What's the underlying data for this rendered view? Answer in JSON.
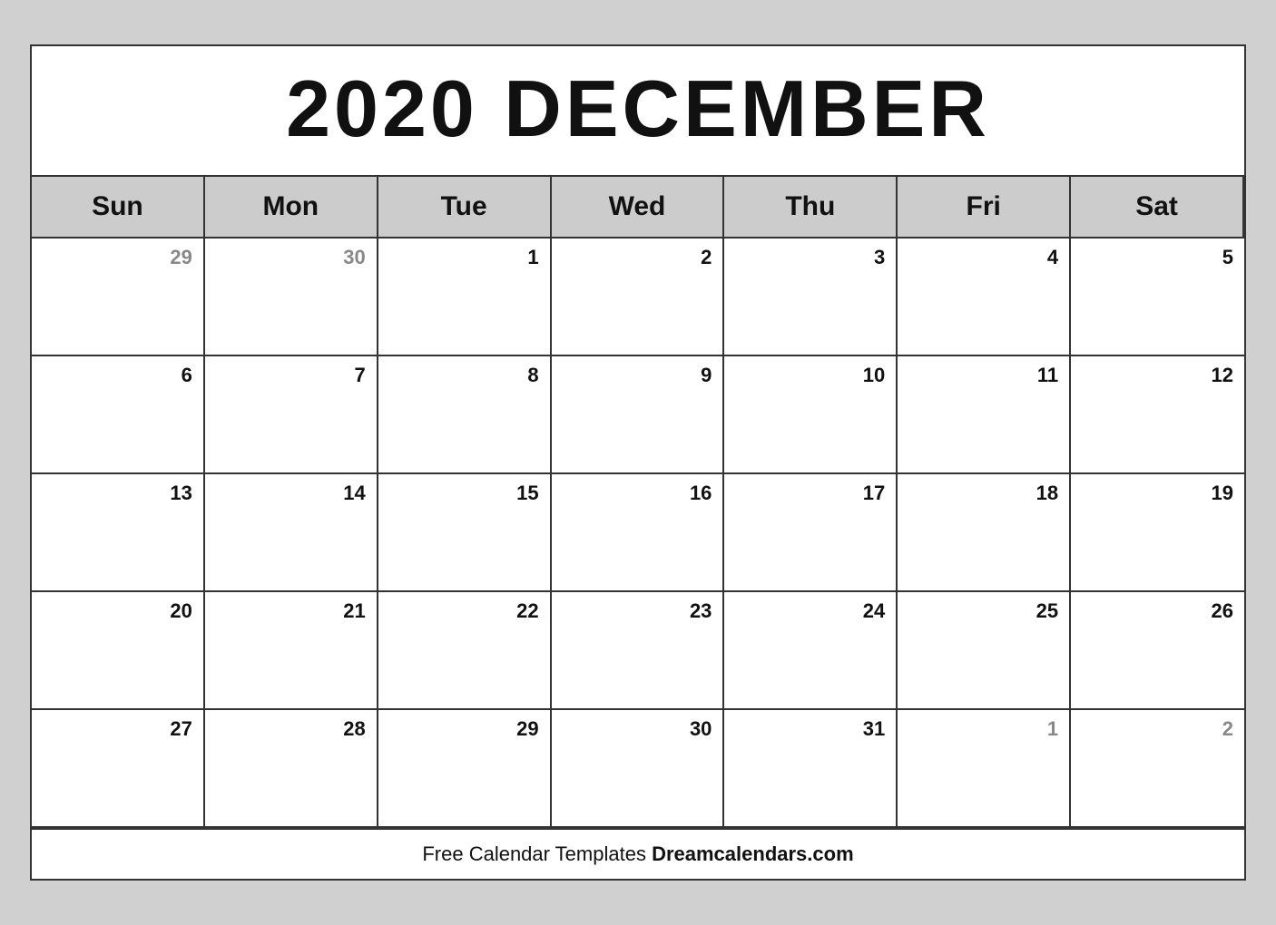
{
  "header": {
    "title": "2020 DECEMBER"
  },
  "day_headers": [
    "Sun",
    "Mon",
    "Tue",
    "Wed",
    "Thu",
    "Fri",
    "Sat"
  ],
  "weeks": [
    [
      {
        "label": "29",
        "outside": true
      },
      {
        "label": "30",
        "outside": true
      },
      {
        "label": "1",
        "outside": false
      },
      {
        "label": "2",
        "outside": false
      },
      {
        "label": "3",
        "outside": false
      },
      {
        "label": "4",
        "outside": false
      },
      {
        "label": "5",
        "outside": false
      }
    ],
    [
      {
        "label": "6",
        "outside": false
      },
      {
        "label": "7",
        "outside": false
      },
      {
        "label": "8",
        "outside": false
      },
      {
        "label": "9",
        "outside": false
      },
      {
        "label": "10",
        "outside": false
      },
      {
        "label": "11",
        "outside": false
      },
      {
        "label": "12",
        "outside": false
      }
    ],
    [
      {
        "label": "13",
        "outside": false
      },
      {
        "label": "14",
        "outside": false
      },
      {
        "label": "15",
        "outside": false
      },
      {
        "label": "16",
        "outside": false
      },
      {
        "label": "17",
        "outside": false
      },
      {
        "label": "18",
        "outside": false
      },
      {
        "label": "19",
        "outside": false
      }
    ],
    [
      {
        "label": "20",
        "outside": false
      },
      {
        "label": "21",
        "outside": false
      },
      {
        "label": "22",
        "outside": false
      },
      {
        "label": "23",
        "outside": false
      },
      {
        "label": "24",
        "outside": false
      },
      {
        "label": "25",
        "outside": false
      },
      {
        "label": "26",
        "outside": false
      }
    ],
    [
      {
        "label": "27",
        "outside": false
      },
      {
        "label": "28",
        "outside": false
      },
      {
        "label": "29",
        "outside": false
      },
      {
        "label": "30",
        "outside": false
      },
      {
        "label": "31",
        "outside": false
      },
      {
        "label": "1",
        "outside": true
      },
      {
        "label": "2",
        "outside": true
      }
    ]
  ],
  "footer": {
    "normal_text": "Free Calendar Templates ",
    "bold_text": "Dreamcalendars.com"
  }
}
